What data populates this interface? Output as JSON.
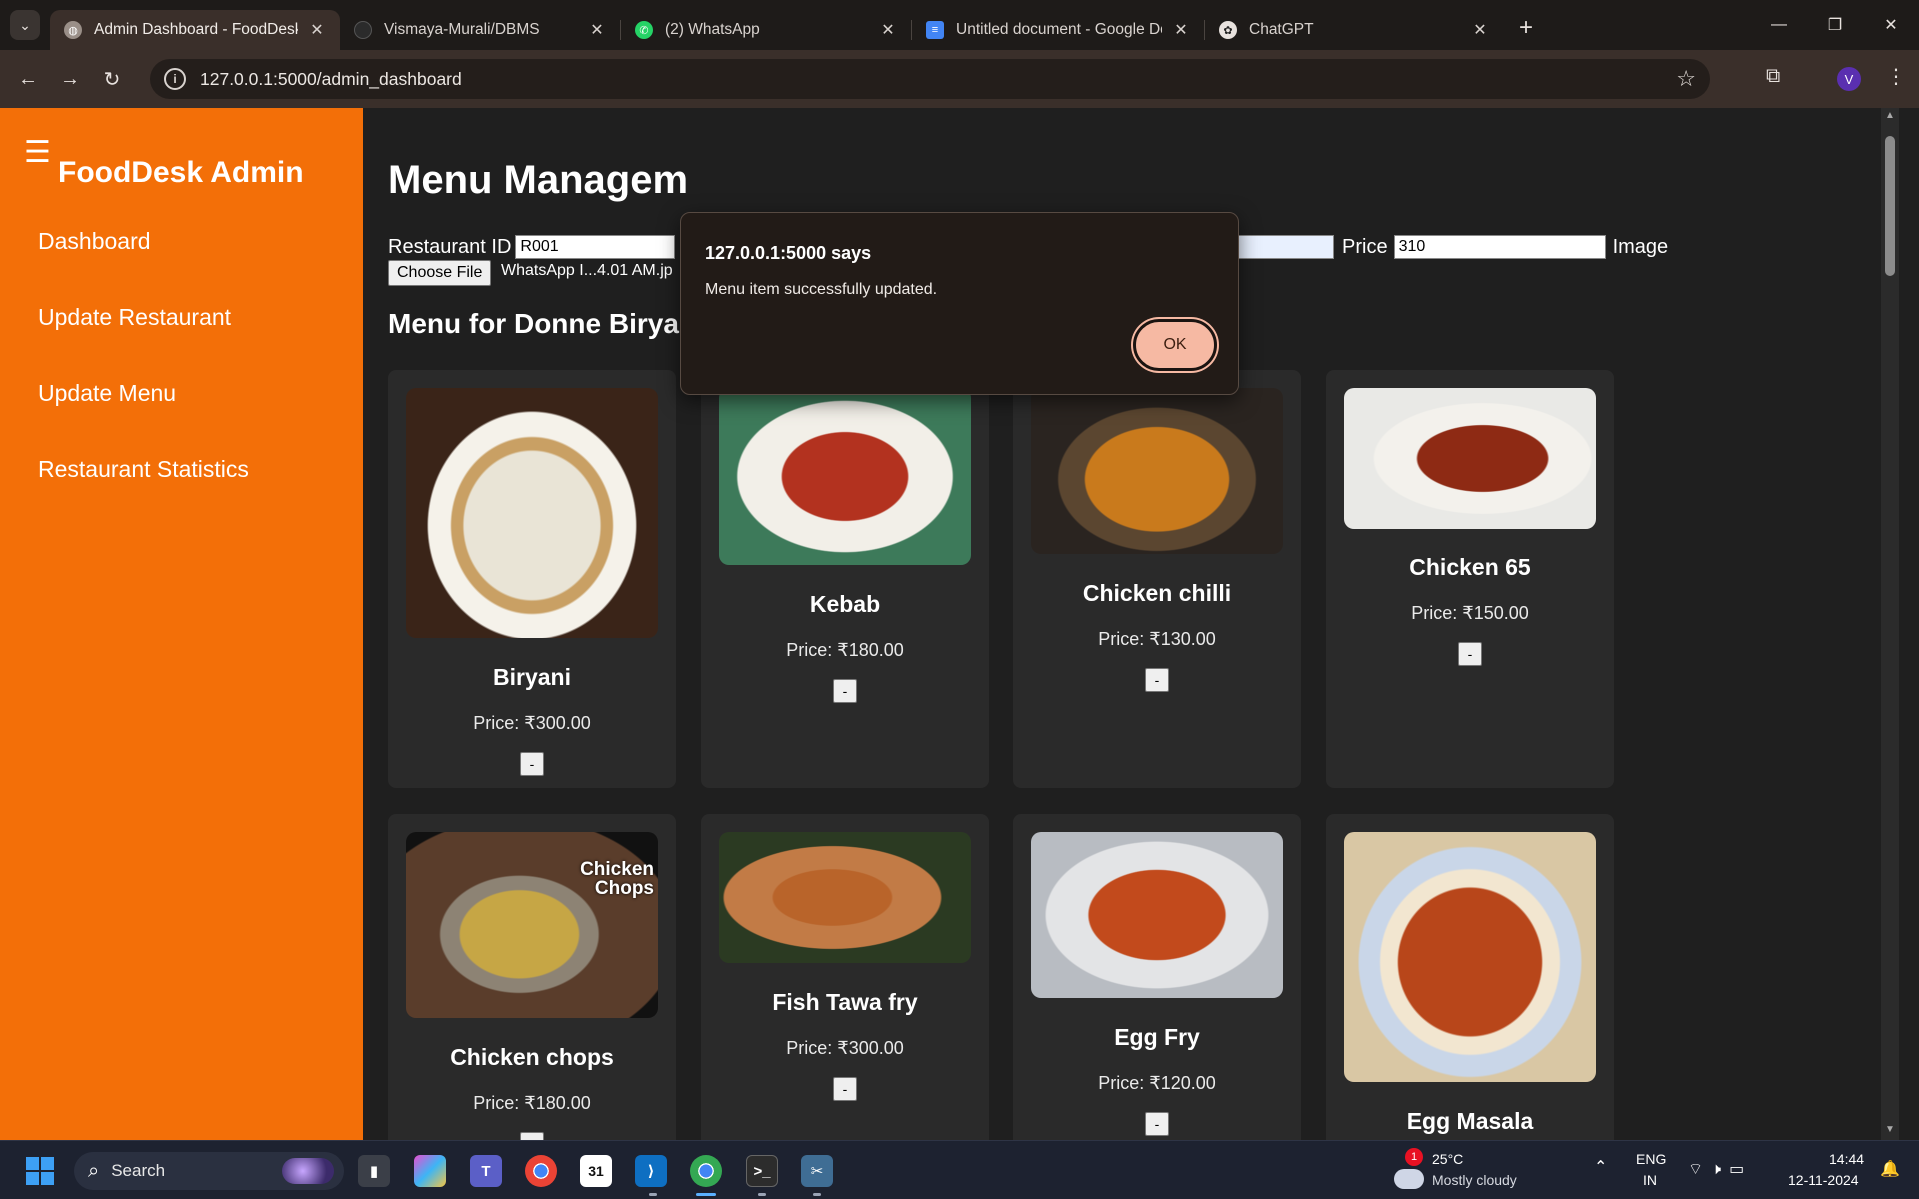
{
  "browser": {
    "tabs": [
      {
        "title": "Admin Dashboard - FoodDesk",
        "active": true,
        "icon": "globe-icon",
        "icon_color": "#9a8f88"
      },
      {
        "title": "Vismaya-Murali/DBMS",
        "active": false,
        "icon": "github-icon",
        "icon_color": "#2b2b2b"
      },
      {
        "title": "(2) WhatsApp",
        "active": false,
        "icon": "whatsapp-icon",
        "icon_color": "#25d366"
      },
      {
        "title": "Untitled document - Google Do",
        "active": false,
        "icon": "google-docs-icon",
        "icon_color": "#4285f4"
      },
      {
        "title": "ChatGPT",
        "active": false,
        "icon": "chatgpt-icon",
        "icon_color": "#e8e2de"
      }
    ],
    "url": "127.0.0.1:5000/admin_dashboard",
    "profile_initial": "V"
  },
  "sidebar": {
    "brand": "FoodDesk Admin",
    "items": [
      {
        "label": "Dashboard"
      },
      {
        "label": "Update Restaurant"
      },
      {
        "label": "Update Menu"
      },
      {
        "label": "Restaurant Statistics"
      }
    ],
    "accent": "#f36f08"
  },
  "main": {
    "title": "Menu Managem",
    "form": {
      "restaurant_id_label": "Restaurant ID",
      "restaurant_id_value": "R001",
      "price_label": "Price",
      "price_value": "310",
      "image_label": "Image",
      "choose_file_label": "Choose File",
      "file_name": "WhatsApp I...4.01 AM.jp"
    },
    "menu_heading": "Menu for Donne Biryani (ID: R001)",
    "delete_label": "-",
    "items": [
      {
        "name": "Biryani",
        "price": "Price: ₹300.00"
      },
      {
        "name": "Kebab",
        "price": "Price: ₹180.00"
      },
      {
        "name": "Chicken chilli",
        "price": "Price: ₹130.00"
      },
      {
        "name": "Chicken 65",
        "price": "Price: ₹150.00"
      },
      {
        "name": "Chicken chops",
        "price": "Price: ₹180.00",
        "image_caption_1": "Chicken",
        "image_caption_2": "Chops"
      },
      {
        "name": "Fish Tawa fry",
        "price": "Price: ₹300.00"
      },
      {
        "name": "Egg Fry",
        "price": "Price: ₹120.00"
      },
      {
        "name": "Egg Masala",
        "price": ""
      }
    ]
  },
  "dialog": {
    "title": "127.0.0.1:5000 says",
    "message": "Menu item successfully updated.",
    "ok_label": "OK"
  },
  "taskbar": {
    "search_label": "Search",
    "weather_temp": "25°C",
    "weather_desc": "Mostly cloudy",
    "weather_badge": "1",
    "lang_1": "ENG",
    "lang_2": "IN",
    "time": "14:44",
    "date": "12-11-2024",
    "calendar_day": "31"
  }
}
